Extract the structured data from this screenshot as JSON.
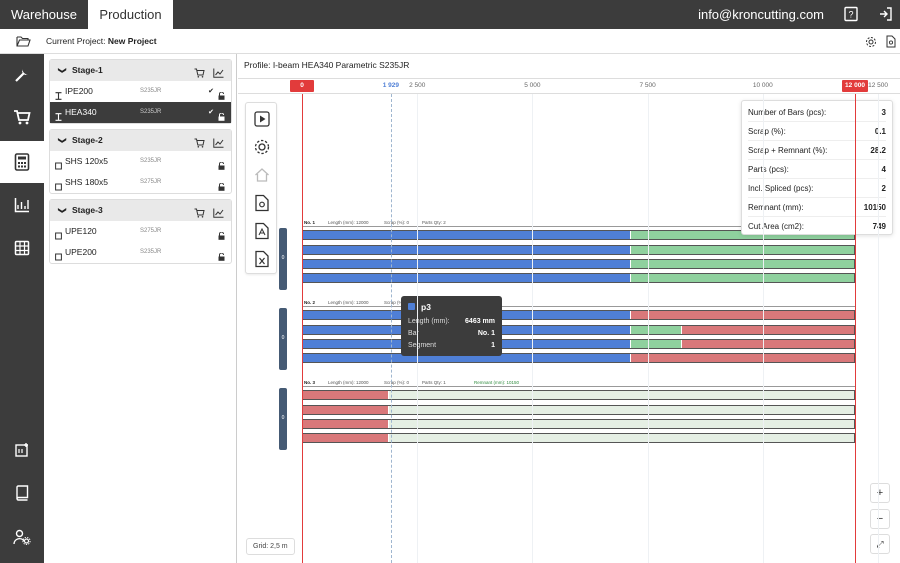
{
  "topbar": {
    "tab_warehouse": "Warehouse",
    "tab_production": "Production",
    "email": "info@kroncutting.com"
  },
  "subbar": {
    "project_label": "Current Project:",
    "project_name": "New Project"
  },
  "nav_icons": [
    "tools-icon",
    "cart-icon",
    "calculator-icon",
    "chart-icon",
    "table-icon",
    "scan-icon",
    "book-icon",
    "user-settings-icon"
  ],
  "tree": {
    "stages": [
      {
        "name": "Stage-1",
        "items": [
          {
            "name": "IPE200",
            "grade": "S235JR",
            "checked": true,
            "selected": false
          },
          {
            "name": "HEA340",
            "grade": "S235JR",
            "checked": true,
            "selected": true
          }
        ]
      },
      {
        "name": "Stage-2",
        "items": [
          {
            "name": "SHS 120x5",
            "grade": "S235JR",
            "checked": false,
            "selected": false
          },
          {
            "name": "SHS 180x5",
            "grade": "S275JR",
            "checked": false,
            "selected": false
          }
        ]
      },
      {
        "name": "Stage-3",
        "items": [
          {
            "name": "UPE120",
            "grade": "S275JR",
            "checked": false,
            "selected": false
          },
          {
            "name": "UPE200",
            "grade": "S235JR",
            "checked": false,
            "selected": false
          }
        ]
      }
    ]
  },
  "main": {
    "profile": "Profile: I-beam HEA340 Parametric S235JR",
    "ruler": {
      "zero": "0",
      "cursor": "1 929",
      "t2500": "2 500",
      "t5000": "5 000",
      "t7500": "7 500",
      "t10000": "10 000",
      "max": "12 000",
      "t12500": "12 500"
    },
    "bar_groups": [
      {
        "no": "No. 1",
        "length": "Length (mm): 12000",
        "scrap": "Scrap (%): 0",
        "parts": "Parts Qty: 2",
        "remnant": "",
        "group_label": "0"
      },
      {
        "no": "No. 2",
        "length": "Length (mm): 12000",
        "scrap": "Scrap (%): 0",
        "parts": "Parts Qty: 1",
        "remnant": "",
        "group_label": "0"
      },
      {
        "no": "No. 3",
        "length": "Length (mm): 12000",
        "scrap": "Scrap (%): 0",
        "parts": "Parts Qty: 1",
        "remnant": "Remnant (mm): 10150",
        "group_label": "0"
      }
    ],
    "stats": [
      {
        "label": "Number of Bars (pcs):",
        "value": "3"
      },
      {
        "label": "Scrap (%):",
        "value": "0.1"
      },
      {
        "label": "Scrap + Remnant (%):",
        "value": "28.2"
      },
      {
        "label": "Parts (pcs):",
        "value": "4"
      },
      {
        "label": "Incl. Spliced (pcs):",
        "value": "2"
      },
      {
        "label": "Remnant (mm):",
        "value": "10150"
      },
      {
        "label": "Cut Area (cm2):",
        "value": "749"
      }
    ],
    "tooltip": {
      "title": "p3",
      "len_label": "Length (mm):",
      "len_value": "6463 mm",
      "bar_label": "Bar",
      "bar_value": "No. 1",
      "seg_label": "Segment",
      "seg_value": "1"
    },
    "zoom": {
      "plus": "+",
      "minus": "−",
      "fit": "⤢"
    },
    "grid": "Grid: 2,5 m"
  },
  "colors": {
    "blue": "#4f7fd6",
    "green": "#8fd19e",
    "red": "#d9787a",
    "pale": "#e5efe4",
    "dark": "#3c3c3c",
    "accent": "#e23b3b"
  }
}
